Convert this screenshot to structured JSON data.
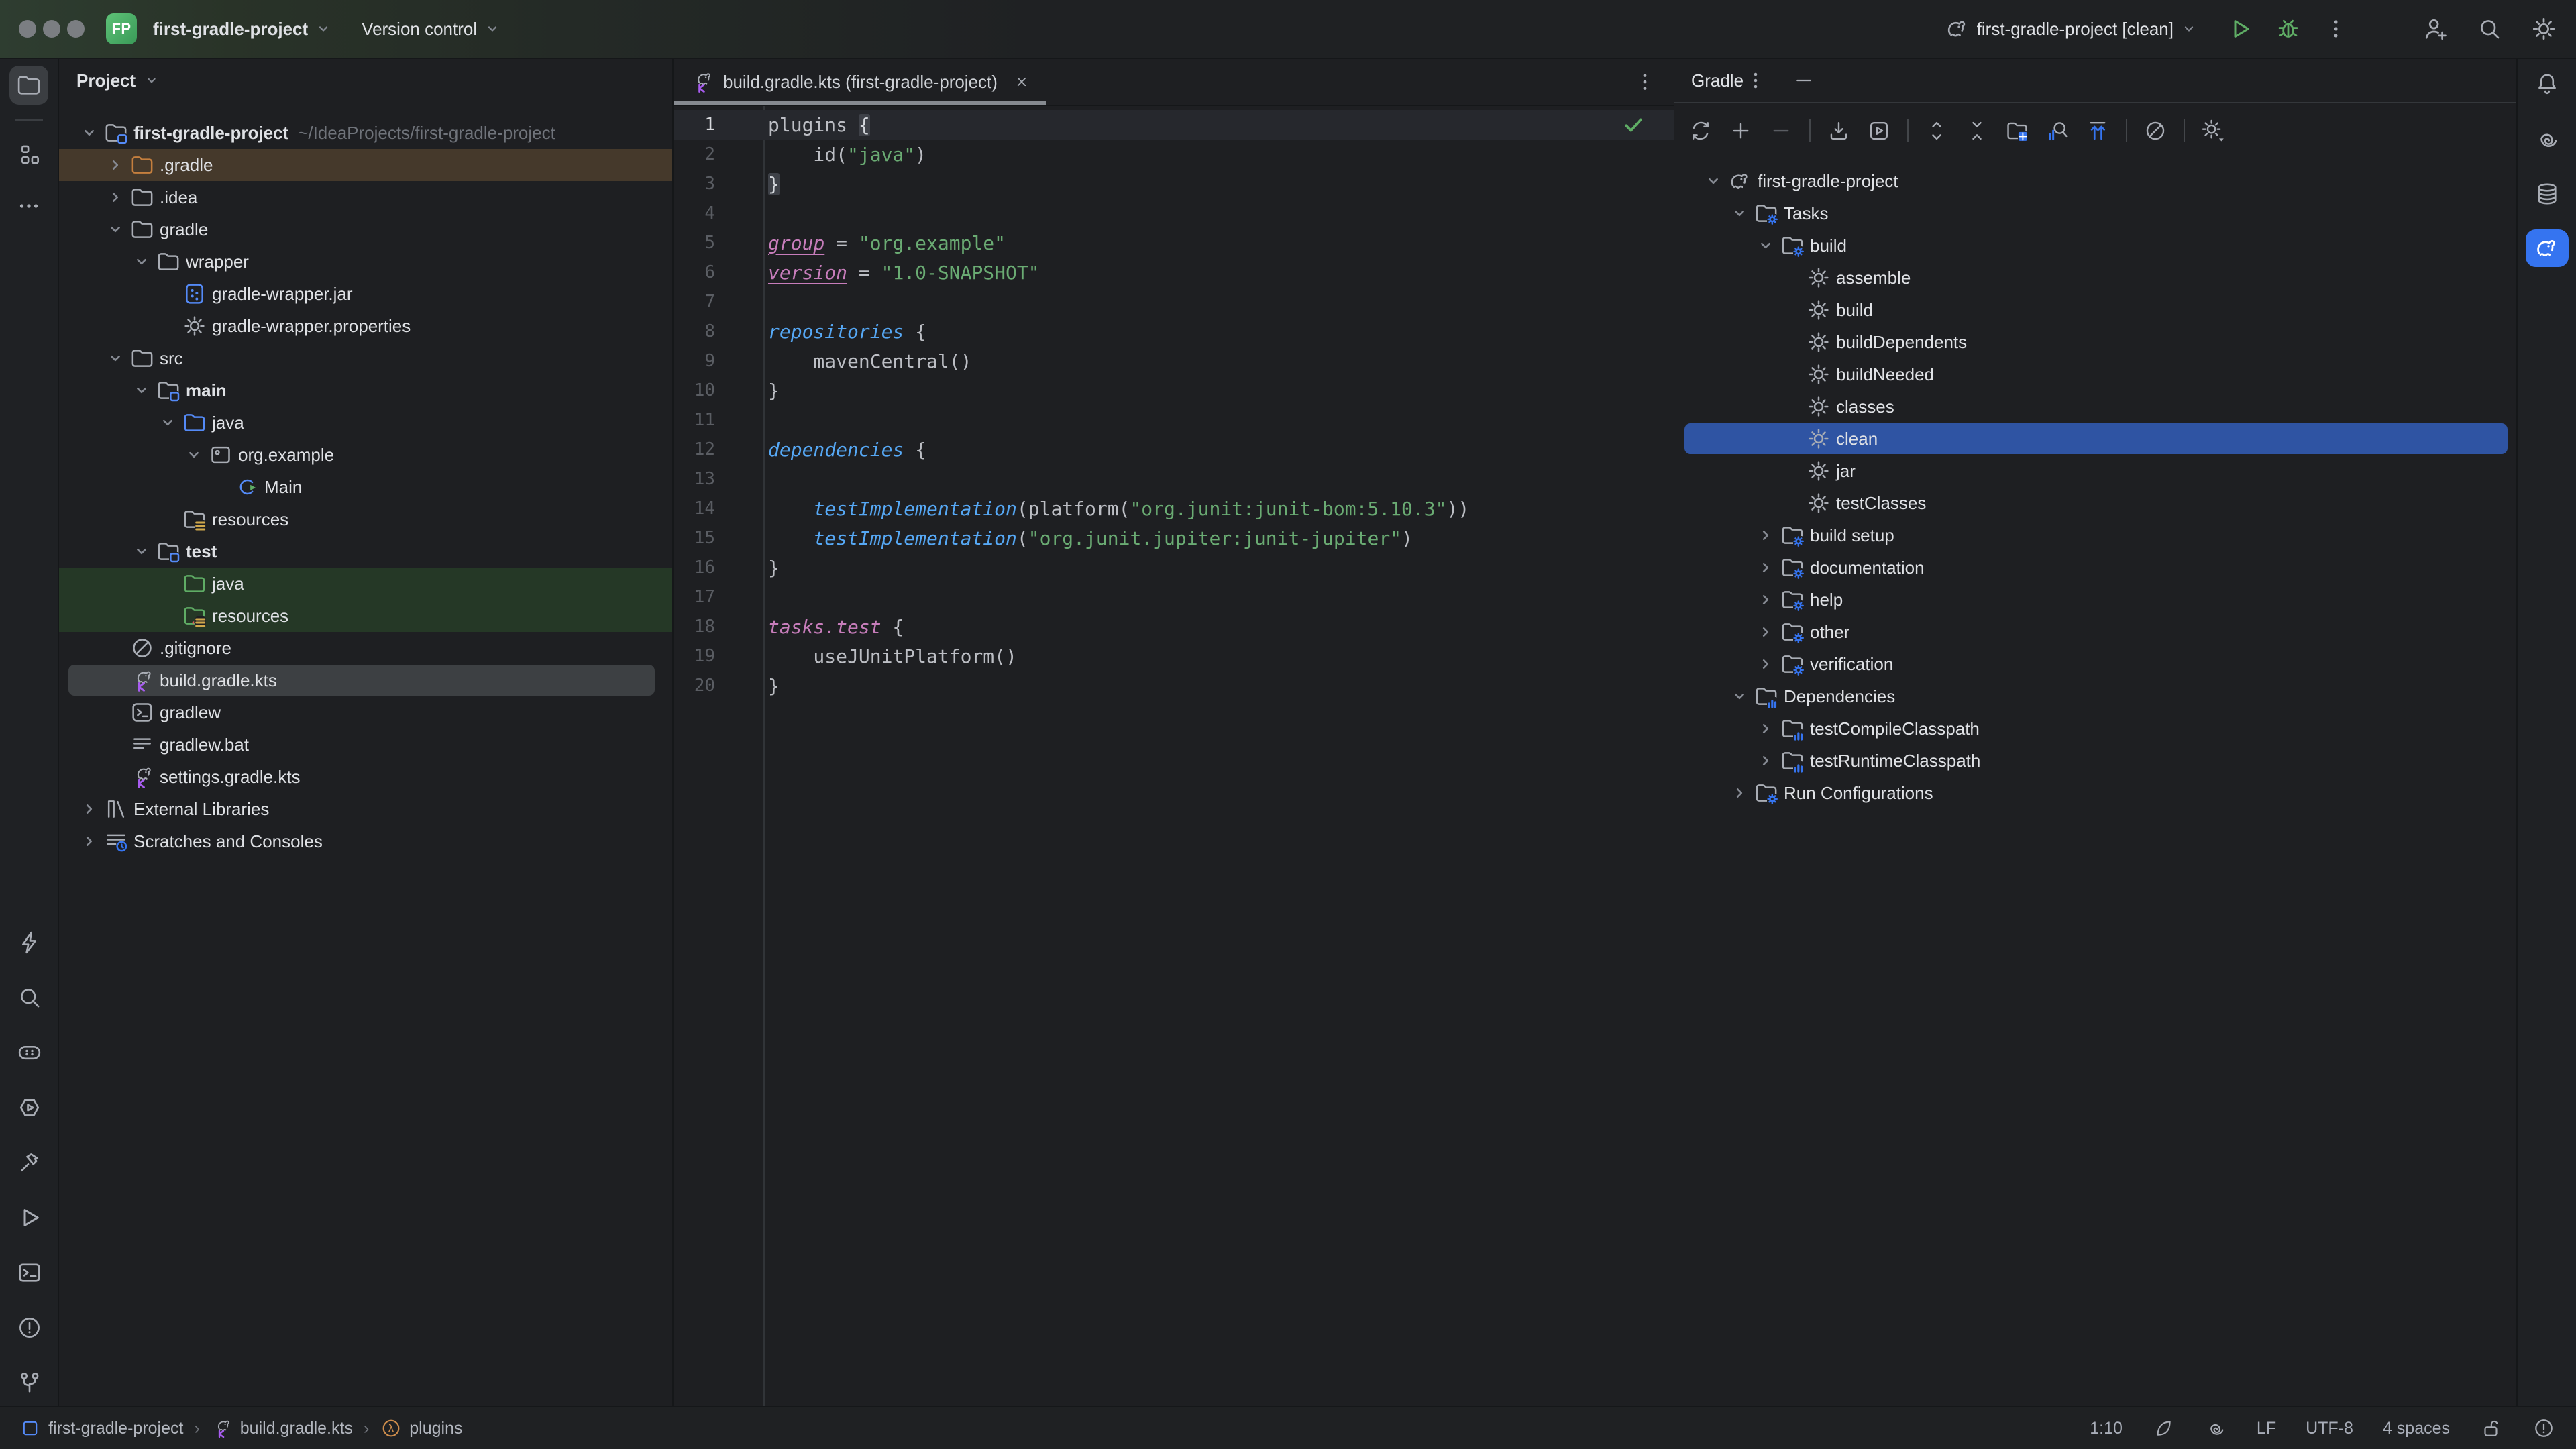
{
  "title_bar": {
    "project_initials": "FP",
    "project_name": "first-gradle-project",
    "menu_version_control": "Version control",
    "run_config": "first-gradle-project [clean]",
    "right_icons": [
      "gradle",
      "run-play",
      "debug-bug",
      "kebab",
      "user-plus",
      "find",
      "gear-big"
    ]
  },
  "left_toolbar": {
    "top": [
      "folder-active",
      "divider",
      "structure",
      "more-h"
    ],
    "bottom": [
      "bolt",
      "find",
      "pill-dots",
      "services",
      "build-hammer",
      "run-play-gray",
      "terminal-tool",
      "problems",
      "git-branch"
    ]
  },
  "right_toolbar": [
    "bell",
    "ai",
    "database",
    "gradle-active"
  ],
  "project_panel": {
    "title": "Project",
    "tree": [
      {
        "l": 0,
        "ch": "d",
        "icon": "folder-module",
        "t": "first-gradle-project",
        "sec": "~/IdeaProjects/first-gradle-project",
        "bold": true
      },
      {
        "l": 1,
        "ch": "r",
        "icon": "folder-orange",
        "t": ".gradle",
        "hl": "ignored"
      },
      {
        "l": 1,
        "ch": "r",
        "icon": "folder",
        "t": ".idea"
      },
      {
        "l": 1,
        "ch": "d",
        "icon": "folder",
        "t": "gradle"
      },
      {
        "l": 2,
        "ch": "d",
        "icon": "folder",
        "t": "wrapper"
      },
      {
        "l": 3,
        "icon": "jar",
        "t": "gradle-wrapper.jar"
      },
      {
        "l": 3,
        "icon": "gear-file",
        "t": "gradle-wrapper.properties"
      },
      {
        "l": 1,
        "ch": "d",
        "icon": "folder",
        "t": "src"
      },
      {
        "l": 2,
        "ch": "d",
        "icon": "folder-module",
        "t": "main",
        "bold": true
      },
      {
        "l": 3,
        "ch": "d",
        "icon": "folder-blue",
        "t": "java"
      },
      {
        "l": 4,
        "ch": "d",
        "icon": "package",
        "t": "org.example"
      },
      {
        "l": 5,
        "icon": "class-main",
        "t": "Main"
      },
      {
        "l": 3,
        "icon": "folder-res",
        "t": "resources"
      },
      {
        "l": 2,
        "ch": "d",
        "icon": "folder-module",
        "t": "test",
        "bold": true
      },
      {
        "l": 3,
        "icon": "folder-green",
        "t": "java",
        "hl": "added"
      },
      {
        "l": 3,
        "icon": "folder-testres",
        "t": "resources",
        "hl": "added"
      },
      {
        "l": 1,
        "icon": "gitignore",
        "t": ".gitignore"
      },
      {
        "l": 1,
        "icon": "gradle-kts",
        "t": "build.gradle.kts",
        "hl": "sel"
      },
      {
        "l": 1,
        "icon": "terminal-file",
        "t": "gradlew"
      },
      {
        "l": 1,
        "icon": "text-file",
        "t": "gradlew.bat"
      },
      {
        "l": 1,
        "icon": "gradle-kts",
        "t": "settings.gradle.kts"
      },
      {
        "l": 0,
        "ch": "r",
        "icon": "library",
        "t": "External Libraries"
      },
      {
        "l": 0,
        "ch": "r",
        "icon": "scratches",
        "t": "Scratches and Consoles"
      }
    ]
  },
  "editor": {
    "tab": {
      "icon": "gradle-kts",
      "title": "build.gradle.kts (first-gradle-project)"
    },
    "inspection_status": "no-problems-check",
    "lines": [
      {
        "n": 1,
        "caret": true,
        "check": true,
        "segs": [
          [
            "p",
            "plugins "
          ],
          [
            "b",
            "{"
          ]
        ]
      },
      {
        "n": 2,
        "segs": [
          [
            "p",
            "    id("
          ],
          [
            "s",
            "\"java\""
          ],
          [
            "p",
            ")"
          ]
        ]
      },
      {
        "n": 3,
        "segs": [
          [
            "b",
            "}"
          ]
        ]
      },
      {
        "n": 4,
        "segs": []
      },
      {
        "n": 5,
        "segs": [
          [
            "pr",
            "group"
          ],
          [
            "p",
            " = "
          ],
          [
            "s",
            "\"org.example\""
          ]
        ]
      },
      {
        "n": 6,
        "segs": [
          [
            "pr",
            "version"
          ],
          [
            "p",
            " = "
          ],
          [
            "s",
            "\"1.0-SNAPSHOT\""
          ]
        ]
      },
      {
        "n": 7,
        "segs": []
      },
      {
        "n": 8,
        "segs": [
          [
            "f",
            "repositories"
          ],
          [
            "p",
            " {"
          ]
        ]
      },
      {
        "n": 9,
        "segs": [
          [
            "p",
            "    mavenCentral()"
          ]
        ]
      },
      {
        "n": 10,
        "segs": [
          [
            "p",
            "}"
          ]
        ]
      },
      {
        "n": 11,
        "segs": []
      },
      {
        "n": 12,
        "segs": [
          [
            "f",
            "dependencies"
          ],
          [
            "p",
            " {"
          ]
        ]
      },
      {
        "n": 13,
        "segs": []
      },
      {
        "n": 14,
        "segs": [
          [
            "p",
            "    "
          ],
          [
            "f",
            "testImplementation"
          ],
          [
            "p",
            "(platform("
          ],
          [
            "s",
            "\"org.junit:junit-bom:5.10.3\""
          ],
          [
            "p",
            "))"
          ]
        ]
      },
      {
        "n": 15,
        "segs": [
          [
            "p",
            "    "
          ],
          [
            "f",
            "testImplementation"
          ],
          [
            "p",
            "("
          ],
          [
            "s",
            "\"org.junit.jupiter:junit-jupiter\""
          ],
          [
            "p",
            ")"
          ]
        ]
      },
      {
        "n": 16,
        "segs": [
          [
            "p",
            "}"
          ]
        ]
      },
      {
        "n": 17,
        "segs": []
      },
      {
        "n": 18,
        "segs": [
          [
            "t",
            "tasks.test"
          ],
          [
            "p",
            " {"
          ]
        ]
      },
      {
        "n": 19,
        "segs": [
          [
            "p",
            "    useJUnitPlatform()"
          ]
        ]
      },
      {
        "n": 20,
        "segs": [
          [
            "p",
            "}"
          ]
        ]
      }
    ]
  },
  "gradle_panel": {
    "title": "Gradle",
    "header_icons": [
      "kebab",
      "minimize"
    ],
    "toolbar": [
      "sync",
      "add",
      "remove",
      "div",
      "download",
      "run-task",
      "div",
      "expand-all",
      "collapse-all",
      "folder-grid",
      "find-task",
      "sort-asc",
      "div",
      "offline",
      "div",
      "settings-caret"
    ],
    "tree": [
      {
        "l": 0,
        "ch": "d",
        "icon": "gradle",
        "t": "first-gradle-project"
      },
      {
        "l": 1,
        "ch": "d",
        "icon": "folder-tasks",
        "t": "Tasks"
      },
      {
        "l": 2,
        "ch": "d",
        "icon": "folder-tasks",
        "t": "build"
      },
      {
        "l": 3,
        "icon": "task",
        "t": "assemble"
      },
      {
        "l": 3,
        "icon": "task",
        "t": "build"
      },
      {
        "l": 3,
        "icon": "task",
        "t": "buildDependents"
      },
      {
        "l": 3,
        "icon": "task",
        "t": "buildNeeded"
      },
      {
        "l": 3,
        "icon": "task",
        "t": "classes"
      },
      {
        "l": 3,
        "icon": "task",
        "t": "clean",
        "hl": "selblue"
      },
      {
        "l": 3,
        "icon": "task",
        "t": "jar"
      },
      {
        "l": 3,
        "icon": "task",
        "t": "testClasses"
      },
      {
        "l": 2,
        "ch": "r",
        "icon": "folder-tasks",
        "t": "build setup"
      },
      {
        "l": 2,
        "ch": "r",
        "icon": "folder-tasks",
        "t": "documentation"
      },
      {
        "l": 2,
        "ch": "r",
        "icon": "folder-tasks",
        "t": "help"
      },
      {
        "l": 2,
        "ch": "r",
        "icon": "folder-tasks",
        "t": "other"
      },
      {
        "l": 2,
        "ch": "r",
        "icon": "folder-tasks",
        "t": "verification"
      },
      {
        "l": 1,
        "ch": "d",
        "icon": "folder-deps",
        "t": "Dependencies"
      },
      {
        "l": 2,
        "ch": "r",
        "icon": "folder-deps",
        "t": "testCompileClasspath"
      },
      {
        "l": 2,
        "ch": "r",
        "icon": "folder-deps",
        "t": "testRuntimeClasspath"
      },
      {
        "l": 1,
        "ch": "r",
        "icon": "folder-tasks",
        "t": "Run Configurations"
      }
    ]
  },
  "status_bar": {
    "breadcrumbs": [
      {
        "icon": "module-sq",
        "label": "first-gradle-project"
      },
      {
        "icon": "gradle-kts",
        "label": "build.gradle.kts"
      },
      {
        "icon": "lambda",
        "label": "plugins"
      }
    ],
    "widgets": {
      "caret": "1:10",
      "line_ending": "LF",
      "encoding": "UTF-8",
      "indent": "4 spaces"
    },
    "widget_icons": [
      "proofread-drop",
      "ai",
      "unlock",
      "error-circle"
    ]
  },
  "colors": {
    "accent_blue": "#3574f0",
    "selection_blue": "#2f54a3",
    "run_green": "#5fad65",
    "string_green": "#6aab73",
    "function_blue": "#56a8f5",
    "property_pink": "#c77dbb",
    "ignored_row": "#45392b",
    "added_row": "#253826",
    "kotlin_purple": "#a85cf0"
  }
}
